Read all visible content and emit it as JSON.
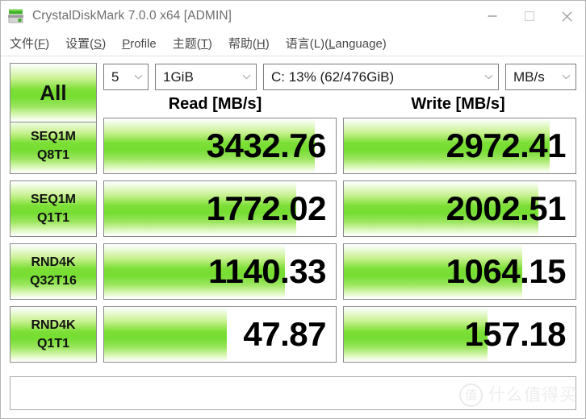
{
  "window": {
    "title": "CrystalDiskMark 7.0.0 x64 [ADMIN]",
    "icon": "disk-drive-icon",
    "controls": {
      "minimize": "minimize-icon",
      "maximize": "maximize-icon",
      "close": "close-icon"
    }
  },
  "menu": {
    "items": [
      {
        "pre": "文件(",
        "key": "F",
        "post": ")"
      },
      {
        "pre": "设置(",
        "key": "S",
        "post": ")"
      },
      {
        "pre": "",
        "key": "P",
        "post": "rofile"
      },
      {
        "pre": "主题(",
        "key": "T",
        "post": ")"
      },
      {
        "pre": "帮助(",
        "key": "H",
        "post": ")"
      },
      {
        "pre": "语言(L)(",
        "key": "L",
        "post": "anguage)"
      }
    ],
    "labels": {
      "file": "文件(F)",
      "settings": "设置(S)",
      "profile": "Profile",
      "theme": "主题(T)",
      "help": "帮助(H)",
      "language": "语言(L)(Language)"
    }
  },
  "toolbar": {
    "all_button": "All",
    "loops": "5",
    "test_size": "1GiB",
    "drive": "C: 13% (62/476GiB)",
    "unit": "MB/s",
    "chevron": "chevron-down-icon"
  },
  "headers": {
    "read": "Read [MB/s]",
    "write": "Write [MB/s]"
  },
  "results": {
    "rows": [
      {
        "label_line1": "SEQ1M",
        "label_line2": "Q8T1",
        "read": "3432.76",
        "write": "2972.41",
        "read_fill_pct": "91",
        "write_fill_pct": "89"
      },
      {
        "label_line1": "SEQ1M",
        "label_line2": "Q1T1",
        "read": "1772.02",
        "write": "2002.51",
        "read_fill_pct": "83",
        "write_fill_pct": "84"
      },
      {
        "label_line1": "RND4K",
        "label_line2": "Q32T16",
        "read": "1140.33",
        "write": "1064.15",
        "read_fill_pct": "78",
        "write_fill_pct": "77"
      },
      {
        "label_line1": "RND4K",
        "label_line2": "Q1T1",
        "read": "47.87",
        "write": "157.18",
        "read_fill_pct": "53",
        "write_fill_pct": "62"
      }
    ]
  },
  "comment": {
    "value": "",
    "placeholder": ""
  },
  "watermark": {
    "mark": "值",
    "text": "什么值得买"
  },
  "colors": {
    "green": "#76dd33",
    "title_text": "#6e6e6e",
    "menu_text": "#4a4a4a",
    "border": "#8a8a8a"
  }
}
